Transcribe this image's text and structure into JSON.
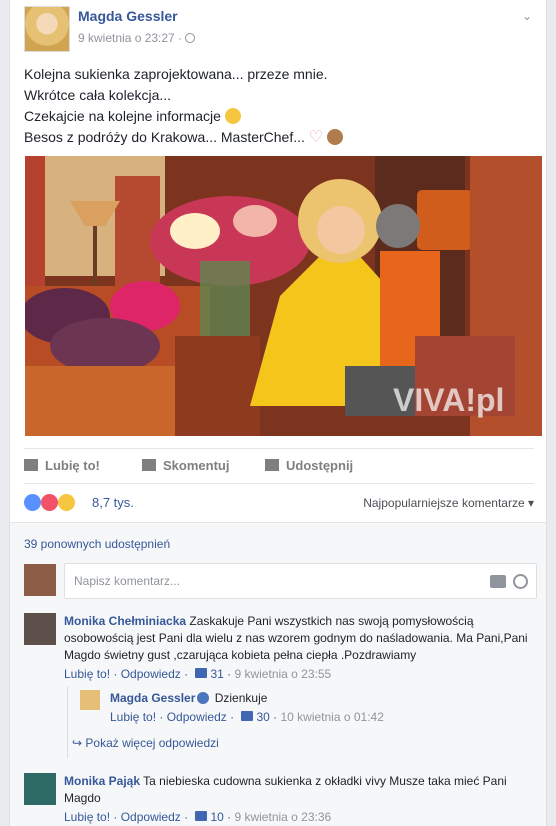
{
  "post": {
    "author": "Magda Gessler",
    "time": "9 kwietnia o 23:27 ·",
    "text": [
      "Kolejna sukienka zaprojektowana... przeze mnie.",
      "Wkrótce cała kolekcja...",
      "Czekajcie na kolejne informacje",
      "Besos z podróży do Krakowa... MasterChef..."
    ],
    "photo": {
      "watermark": "VIVA!pl"
    }
  },
  "actions": {
    "like": "Lubię to!",
    "comment": "Skomentuj",
    "share": "Udostępnij"
  },
  "reactions": {
    "count": "8,7 tys.",
    "sort": "Najpopularniejsze komentarze"
  },
  "shares": "39 ponownych udostępnień",
  "composer": {
    "placeholder": "Napisz komentarz..."
  },
  "comments": [
    {
      "author": "Monika Chełminiacka",
      "text": "Zaskakuje Pani wszystkich nas swoją pomysłowością osobowością jest Pani dla wielu z nas wzorem godnym do naśladowania. Ma Pani,Pani Magdo świetny gust ,czarująca kobieta pełna ciepła .Pozdrawiamy",
      "like": "Lubię to!",
      "reply": "Odpowiedz",
      "likes": "31",
      "time": "9 kwietnia o 23:55",
      "replies": [
        {
          "author": "Magda Gessler",
          "text": "Dzienkuje",
          "like": "Lubię to!",
          "reply": "Odpowiedz",
          "likes": "30",
          "time": "10 kwietnia o 01:42"
        }
      ],
      "more": "Pokaż więcej odpowiedzi"
    },
    {
      "author": "Monika Pająk",
      "text": "Ta niebieska cudowna sukienka z okładki vivy Musze taka mieć Pani Magdo",
      "like": "Lubię to!",
      "reply": "Odpowiedz",
      "likes": "10",
      "time": "9 kwietnia o 23:36"
    }
  ]
}
